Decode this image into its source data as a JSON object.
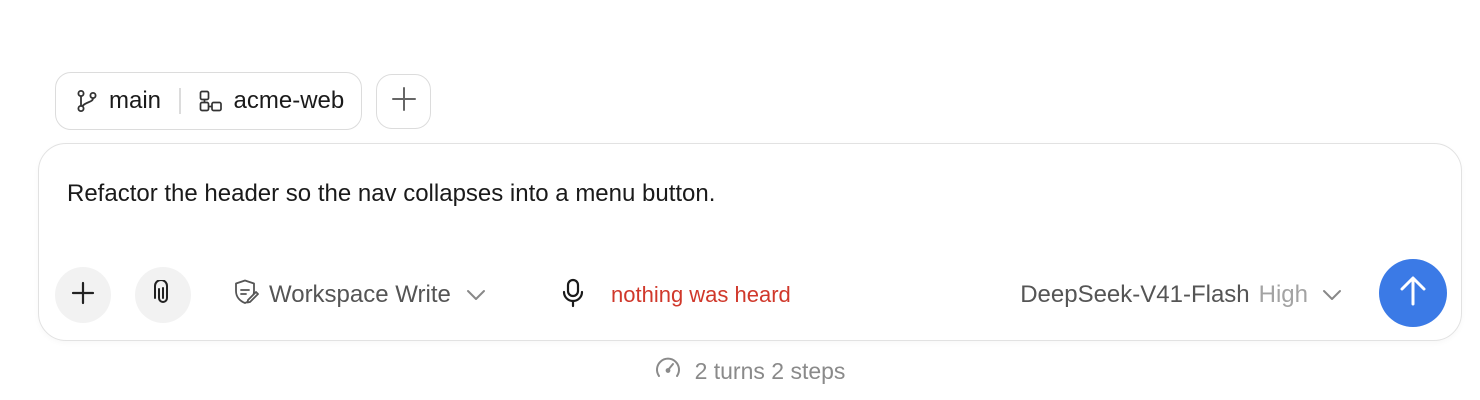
{
  "context": {
    "branch": "main",
    "repo": "acme-web"
  },
  "composer": {
    "prompt_text": "Refactor the header so the nav collapses into a menu button.",
    "permission_label": "Workspace Write",
    "voice_status": "nothing was heard",
    "model_name": "DeepSeek-V41-Flash",
    "model_effort": "High"
  },
  "usage": {
    "summary": "2 turns 2 steps"
  },
  "colors": {
    "accent": "#3b7ae6",
    "error": "#d0382b",
    "muted": "#8a8a8a"
  },
  "icons": {
    "branch": "git-branch-icon",
    "repo": "repo-icon",
    "add": "plus-icon",
    "attach": "paperclip-icon",
    "permission": "shield-edit-icon",
    "chevron": "chevron-down-icon",
    "mic": "microphone-icon",
    "send": "arrow-up-icon",
    "usage": "gauge-icon"
  }
}
